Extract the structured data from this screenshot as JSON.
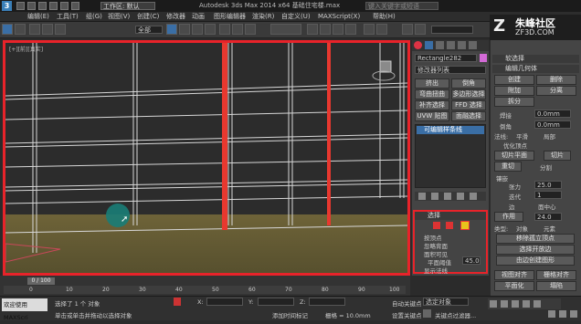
{
  "titlebar": {
    "workspace_label": "工作区: 默认",
    "app_title": "Autodesk 3ds Max 2014 x64    基础住宅楼.max",
    "search_placeholder": "键入关键字或短语"
  },
  "menu": [
    "编辑(E)",
    "工具(T)",
    "组(G)",
    "视图(V)",
    "创建(C)",
    "修改器",
    "动画",
    "图形编辑器",
    "渲染(R)",
    "自定义(U)",
    "MAXScript(X)",
    "帮助(H)"
  ],
  "toolbar": {
    "filter": "全部"
  },
  "watermark": {
    "mark": "Z",
    "name": "朱峰社区",
    "url": "ZF3D.COM"
  },
  "viewport": {
    "label": "[+][前][真实]"
  },
  "modifier_panel": {
    "object_name": "Rectangle282",
    "modifier_list": "修改器列表",
    "buttons": [
      [
        "挤出",
        "倒角"
      ],
      [
        "弯曲扭曲",
        "多边形选择"
      ],
      [
        "补齐选择",
        "FFD 选择"
      ],
      [
        "UVW 贴图",
        "面融选择"
      ]
    ],
    "stack_item": "可编辑样条线",
    "selection_header": "选择",
    "checks": [
      "按顶点",
      "忽略背面",
      "面积可见"
    ],
    "plane_threshold_label": "平面阈值",
    "plane_threshold_value": "45.0",
    "show_normals": "显示法线",
    "scale_label": "比例:",
    "scale_value": "20.0",
    "remove_isolated": "删除孤立"
  },
  "command_panel": {
    "soft_selection": "软选择",
    "edit_geometry": "编辑几何体",
    "buttons_row1": [
      "创建",
      "删除"
    ],
    "buttons_row2": [
      "附加",
      "分离"
    ],
    "buttons_row3": [
      "拆分"
    ],
    "weld_label": "焊接",
    "weld_value": "0.0mm",
    "chamfer_label": "倒角",
    "chamfer_value": "0.0mm",
    "normal_label": "法线:",
    "normal_opt1": "平滑",
    "normal_opt2": "局部",
    "optimize": "优化顶点",
    "cut_plane": "切片平面",
    "slice": "切片",
    "reset": "重切",
    "split": "分割",
    "tess_header": "镶嵌",
    "tension_label": "张力",
    "tension_value": "25.0",
    "iterations_label": "迭代",
    "iterations_value": "1",
    "edges_label": "边",
    "face_center": "面中心",
    "collapse_label": "作用",
    "collapse_value": "24.0",
    "type_label": "类型:",
    "type_object": "对象",
    "type_element": "元素",
    "remove_isolated": "移除孤立顶点",
    "select_open": "选择开放边",
    "from_edges": "由边创建图形",
    "view_align": "视图对齐",
    "grid_align": "栅格对齐",
    "planarize": "平面化",
    "collapse": "塌陷"
  },
  "timeline": {
    "frame": "0 / 100",
    "ticks": [
      "0",
      "10",
      "20",
      "30",
      "40",
      "50",
      "60",
      "70",
      "80",
      "90",
      "100"
    ]
  },
  "statusbar": {
    "welcome": "欢迎使用 MAXScri",
    "selected": "选择了 1 个 对象",
    "hint": "单击或单击并拖动以选择对象",
    "x_label": "X:",
    "y_label": "Y:",
    "z_label": "Z:",
    "grid_label": "栅格 = 10.0mm",
    "autokey": "自动关键点",
    "set_key": "设置关键点",
    "selected_obj": "选定对象",
    "add_marker": "添加时间标记",
    "key_filter": "关键点过滤器..."
  }
}
